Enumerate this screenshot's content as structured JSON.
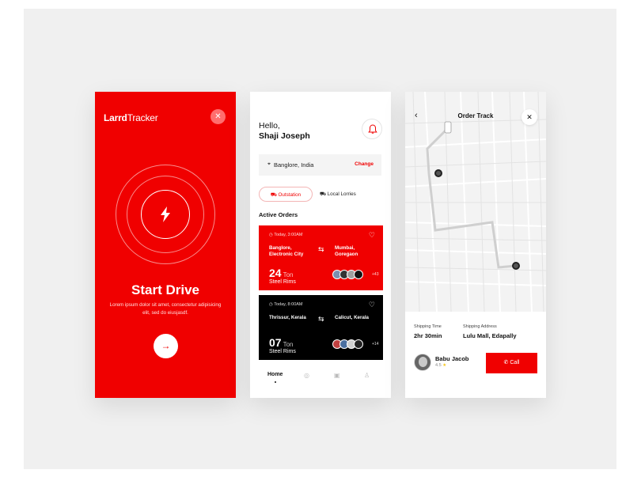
{
  "screen1": {
    "logo_bold": "Larrd",
    "logo_regular": "Tracker",
    "close_symbol": "✕",
    "title": "Start Drive",
    "description": "Lorem ipsum dolor sit amet, consectetur adipisicing elit, sed do eiusjasdf.",
    "go_symbol": "→",
    "icon": "lightning-bolt-icon",
    "accent": "#f00000"
  },
  "screen2": {
    "greeting": "Hello,",
    "user_name": "Shaji Joseph",
    "location": "Banglore, India",
    "change_label": "Change",
    "tabs": [
      "Outstation",
      "Local Lorries"
    ],
    "active_orders_heading": "Active Orders",
    "orders": [
      {
        "time": "Today, 3:00AM",
        "from": "Banglore, Electronic City",
        "to": "Mumbai, Goregaon",
        "weight": "24",
        "unit": "Ton",
        "item": "Steel Rims",
        "extra": "+43",
        "color": "#f00000"
      },
      {
        "time": "Today, 8:00AM",
        "from": "Thrissur, Kerala",
        "to": "Calicut, Kerala",
        "weight": "07",
        "unit": "Ton",
        "item": "Steel Rims",
        "extra": "+14",
        "color": "#000000"
      }
    ],
    "nav": {
      "home": "Home"
    }
  },
  "screen3": {
    "title": "Order Track",
    "shipping_time_label": "Shipping Time",
    "shipping_time": "2hr 30min",
    "shipping_address_label": "Shipping Address",
    "shipping_address": "Lulu Mall, Edapally",
    "driver_name": "Babu Jacob",
    "driver_rating": "4.5",
    "call_label": "Call"
  }
}
